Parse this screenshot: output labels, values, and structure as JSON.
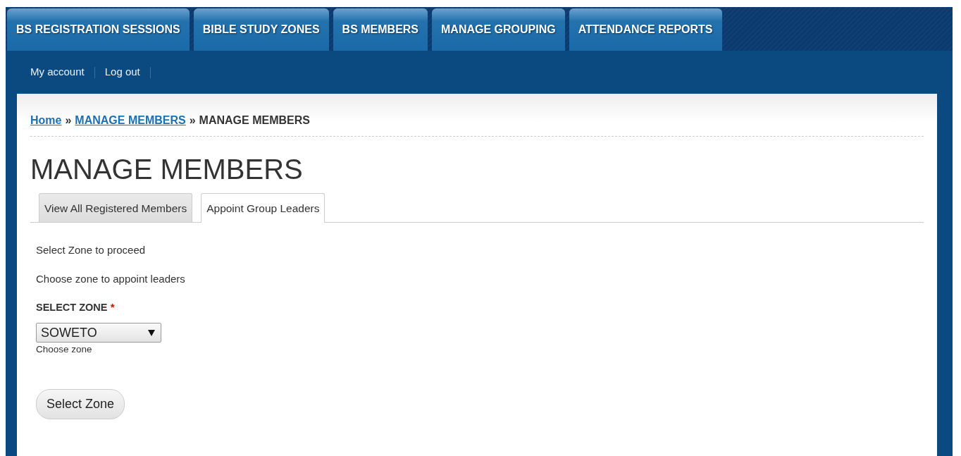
{
  "main_nav": [
    {
      "label": "BS REGISTRATION SESSIONS"
    },
    {
      "label": "BIBLE STUDY ZONES"
    },
    {
      "label": "BS MEMBERS"
    },
    {
      "label": "MANAGE GROUPING"
    },
    {
      "label": "ATTENDANCE REPORTS"
    }
  ],
  "account_links": [
    "My account",
    "Log out"
  ],
  "breadcrumb": {
    "links": [
      "Home",
      "MANAGE MEMBERS"
    ],
    "separator": "»",
    "current": "MANAGE MEMBERS"
  },
  "page_title": "MANAGE MEMBERS",
  "tabs": [
    {
      "label": "View All Registered Members",
      "selected": false
    },
    {
      "label": "Appoint Group Leaders",
      "selected": true
    }
  ],
  "intro": [
    "Select Zone to proceed",
    "Choose zone to appoint leaders"
  ],
  "zone_field": {
    "label": "SELECT ZONE",
    "required_mark": "*",
    "value": "SOWETO",
    "description": "Choose zone"
  },
  "submit_button": "Select Zone"
}
